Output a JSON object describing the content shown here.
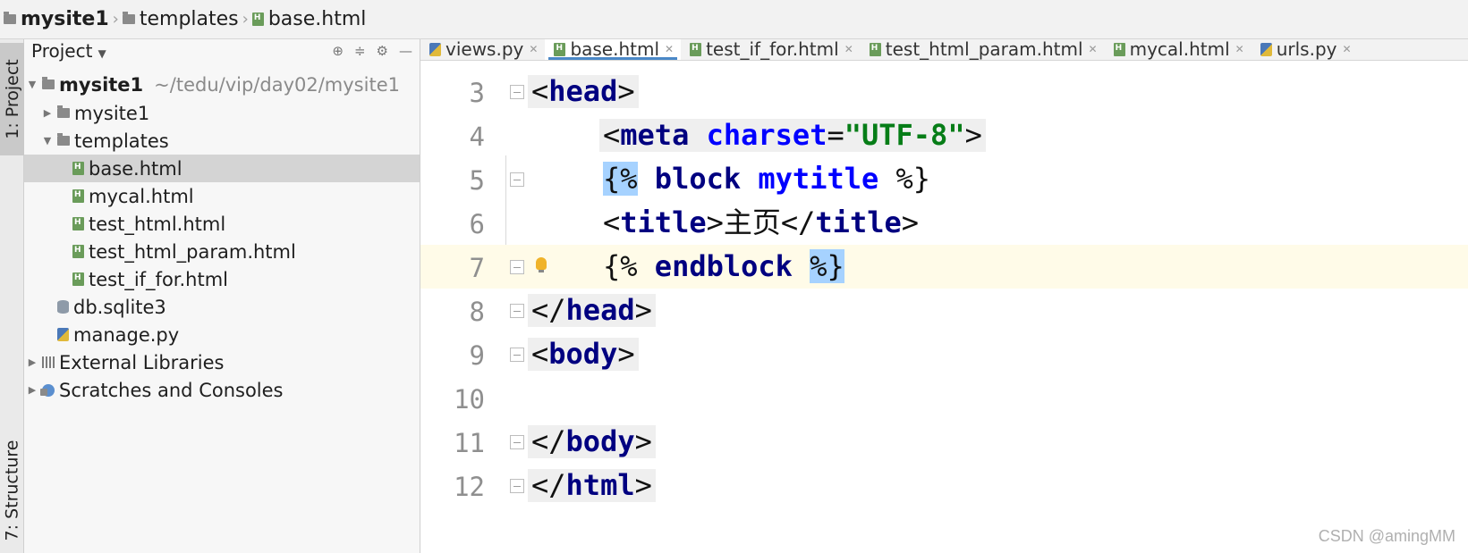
{
  "breadcrumb": {
    "root": "mysite1",
    "folder": "templates",
    "file": "base.html"
  },
  "tool_windows": {
    "project_tab": "1: Project",
    "structure_tab": "7: Structure"
  },
  "project_panel": {
    "title": "Project",
    "root_name": "mysite1",
    "root_path": "~/tedu/vip/day02/mysite1",
    "items": [
      {
        "label": "mysite1"
      },
      {
        "label": "templates"
      },
      {
        "label": "base.html"
      },
      {
        "label": "mycal.html"
      },
      {
        "label": "test_html.html"
      },
      {
        "label": "test_html_param.html"
      },
      {
        "label": "test_if_for.html"
      },
      {
        "label": "db.sqlite3"
      },
      {
        "label": "manage.py"
      },
      {
        "label": "External Libraries"
      },
      {
        "label": "Scratches and Consoles"
      }
    ]
  },
  "tabs": [
    {
      "label": "views.py"
    },
    {
      "label": "base.html"
    },
    {
      "label": "test_if_for.html"
    },
    {
      "label": "test_html_param.html"
    },
    {
      "label": "mycal.html"
    },
    {
      "label": "urls.py"
    }
  ],
  "editor": {
    "line_numbers": [
      "3",
      "4",
      "5",
      "6",
      "7",
      "8",
      "9",
      "10",
      "11",
      "12"
    ],
    "l3": {
      "open": "<",
      "name": "head",
      "close": ">"
    },
    "l4": {
      "open": "<",
      "name": "meta",
      "sp": " ",
      "attr": "charset",
      "eq": "=",
      "val": "\"UTF-8\"",
      "close": ">"
    },
    "l5": {
      "open": "{%",
      "sp1": " ",
      "kw": "block",
      "sp2": " ",
      "name": "mytitle",
      "sp3": " ",
      "close": "%}"
    },
    "l6": {
      "open": "<",
      "name": "title",
      "close": ">",
      "text": "主页",
      "open2": "</",
      "name2": "title",
      "close2": ">"
    },
    "l7": {
      "open": "{%",
      "sp1": " ",
      "kw": "endblock",
      "sp2": " ",
      "close_hl": "%",
      "close_end": "}"
    },
    "l8": {
      "open": "</",
      "name": "head",
      "close": ">"
    },
    "l9": {
      "open": "<",
      "name": "body",
      "close": ">"
    },
    "l11": {
      "open": "</",
      "name": "body",
      "close": ">"
    },
    "l12": {
      "open": "</",
      "name": "html",
      "close": ">"
    }
  },
  "watermark": "CSDN @amingMM"
}
